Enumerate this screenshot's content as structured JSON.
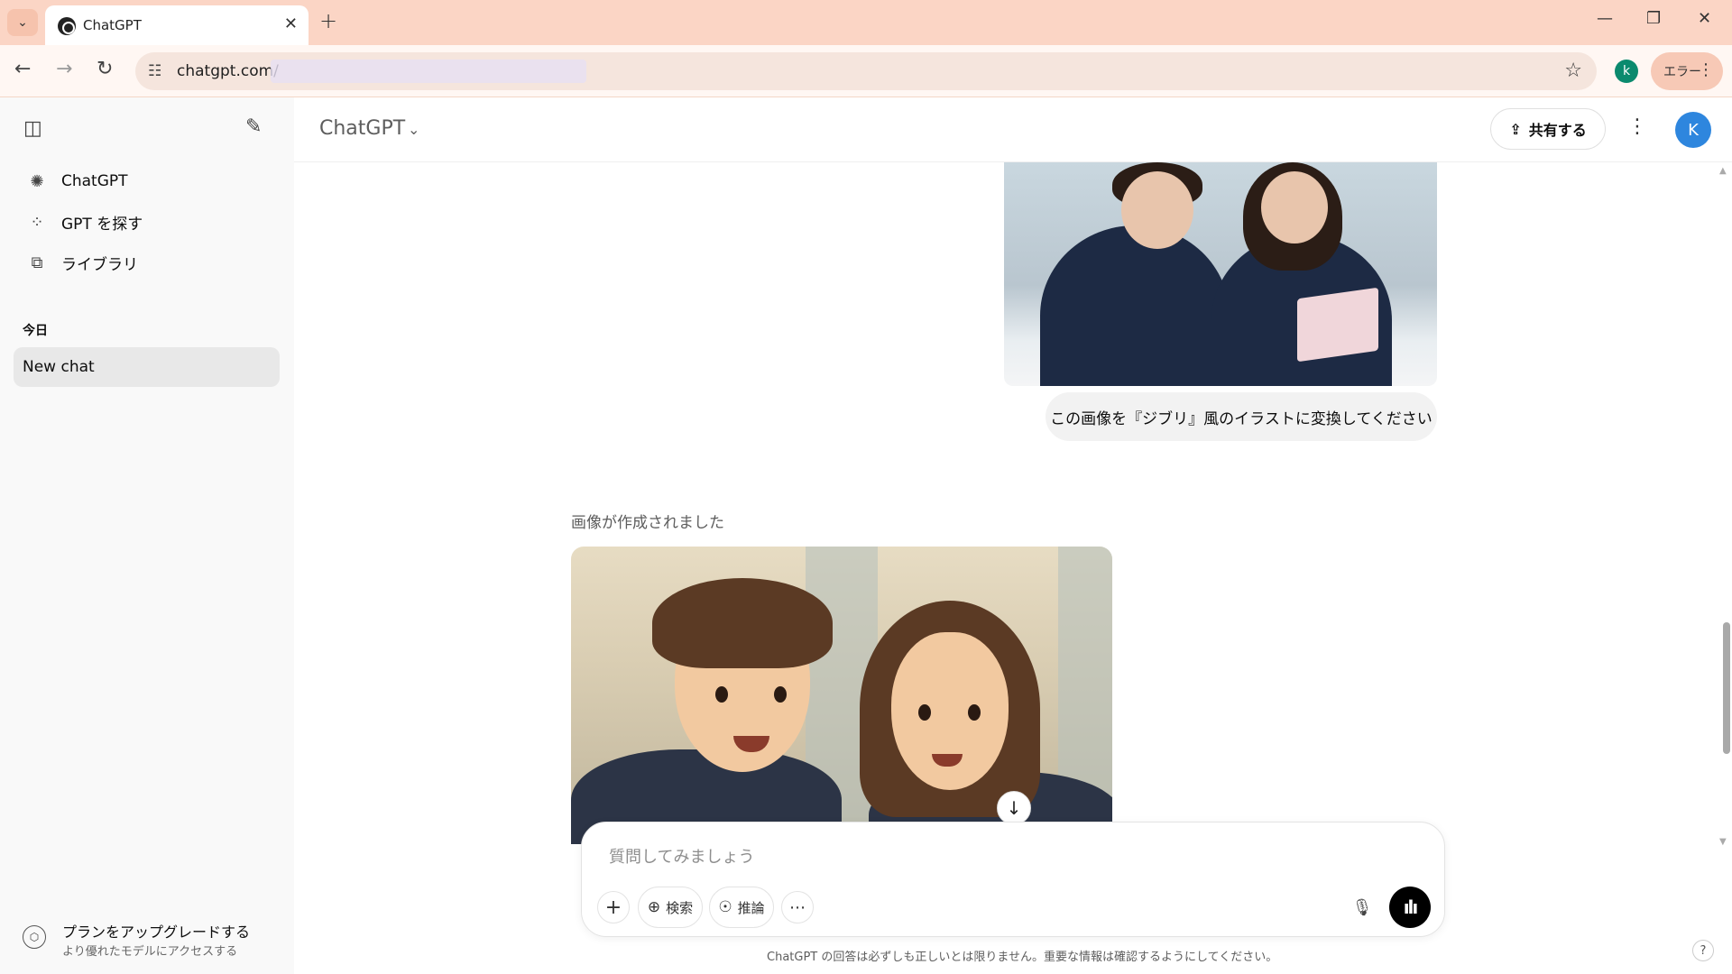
{
  "browser": {
    "tab_title": "ChatGPT",
    "new_tab": "+",
    "url": "chatgpt.com/",
    "profile_initial": "k",
    "error_chip": "エラー"
  },
  "sidebar": {
    "items": [
      {
        "label": "ChatGPT",
        "icon": "openai-logo-icon"
      },
      {
        "label": "GPT を探す",
        "icon": "grid-icon"
      },
      {
        "label": "ライブラリ",
        "icon": "library-icon"
      }
    ],
    "section_today": "今日",
    "chats": [
      {
        "label": "New chat"
      }
    ],
    "upgrade": {
      "title": "プランをアップグレードする",
      "subtitle": "より優れたモデルにアクセスする"
    }
  },
  "header": {
    "model": "ChatGPT",
    "share_label": "共有する",
    "avatar_initial": "K"
  },
  "conversation": {
    "user_message": "この画像を『ジブリ』風のイラストに変換してください",
    "assistant_status": "画像が作成されました"
  },
  "composer": {
    "placeholder": "質問してみましょう",
    "search_label": "検索",
    "reason_label": "推論"
  },
  "disclaimer": "ChatGPT の回答は必ずしも正しいとは限りません。重要な情報は確認するようにしてください。",
  "help": "?",
  "colors": {
    "tabbar": "#fbd5c5",
    "sidebar_bg": "#f9f9f9",
    "avatar": "#2e86de",
    "profile": "#0b8a6e"
  }
}
